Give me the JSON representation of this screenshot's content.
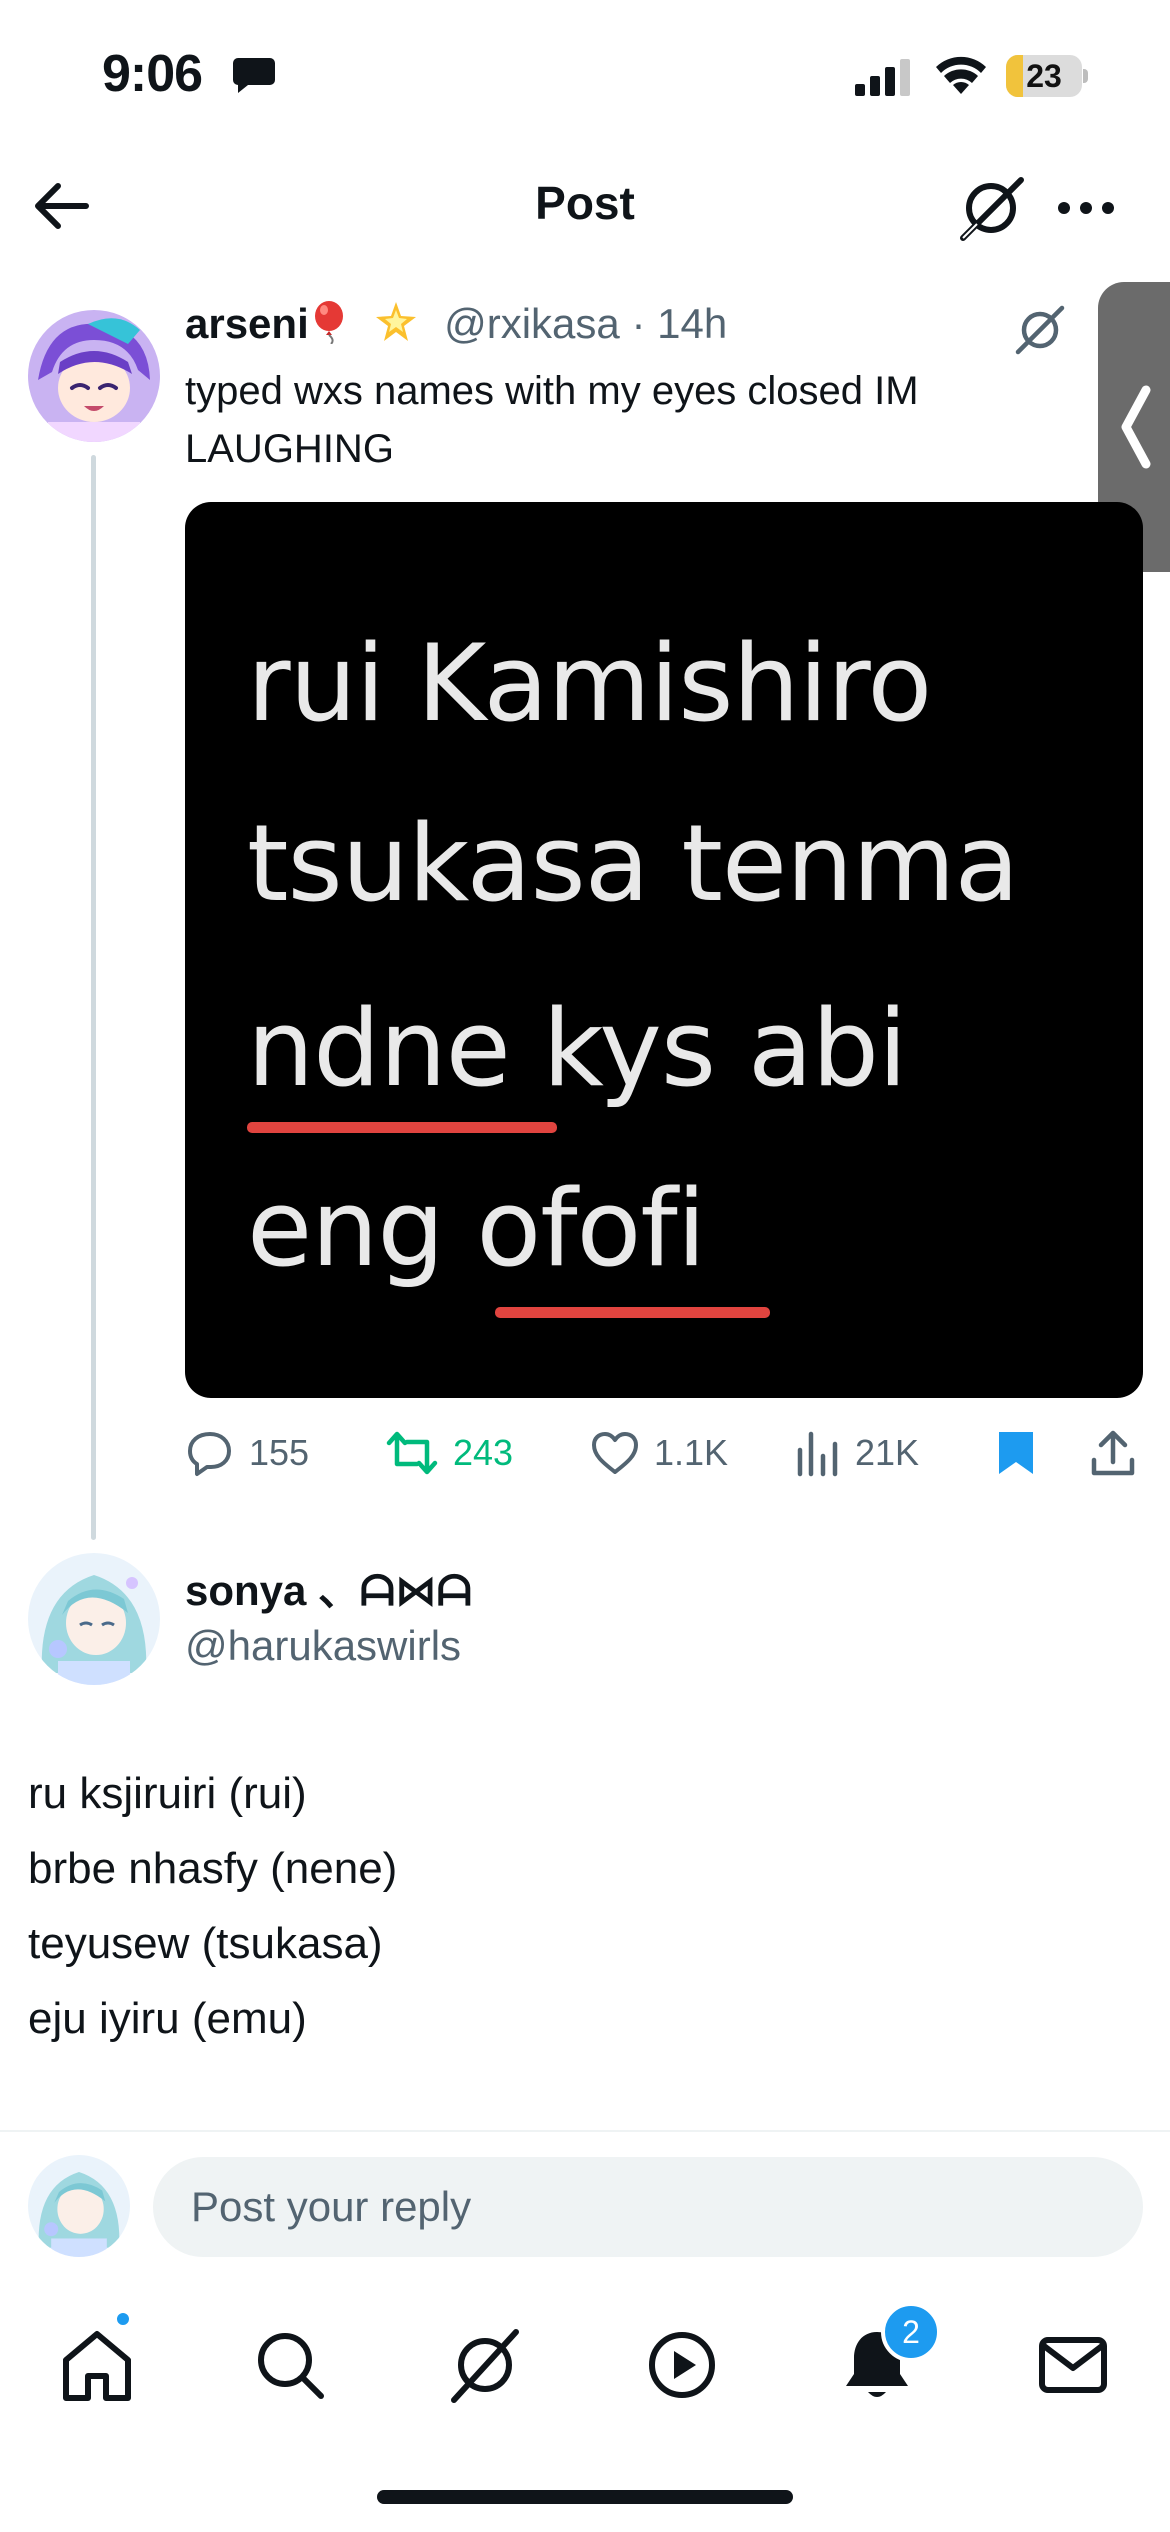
{
  "status": {
    "time": "9:06",
    "battery": "23",
    "battery_level": 0.23
  },
  "header": {
    "title": "Post"
  },
  "post": {
    "name": "arseni",
    "handle": "@rxikasa",
    "separator": "·",
    "time": "14h",
    "text": "typed wxs names with my eyes closed IM LAUGHING",
    "image_lines": [
      "rui Kamishiro",
      "tsukasa tenma",
      "ndne kys abi",
      "eng ofofi"
    ],
    "stats": {
      "replies": "155",
      "reposts": "243",
      "likes": "1.1K",
      "views": "21K"
    },
    "bookmarked": true
  },
  "reply": {
    "name": "sonya 、ᗩ⋈ᗩ",
    "handle": "@harukaswirls",
    "lines": [
      "ru ksjiruiri (rui)",
      "brbe nhasfy (nene)",
      "teyusew (tsukasa)",
      "eju iyiru (emu)"
    ]
  },
  "composer": {
    "placeholder": "Post your reply"
  },
  "tabbar": {
    "notifications_badge": "2"
  },
  "colors": {
    "accent": "#1d9bf0",
    "repost": "#00ba7c",
    "muted": "#536471",
    "underline": "#e0443f"
  },
  "icons": [
    "back-arrow-icon",
    "grok-icon",
    "more-icon",
    "reply-icon",
    "repost-icon",
    "like-icon",
    "views-icon",
    "bookmark-icon",
    "share-icon",
    "home-icon",
    "search-icon",
    "play-icon",
    "bell-icon",
    "mail-icon"
  ]
}
